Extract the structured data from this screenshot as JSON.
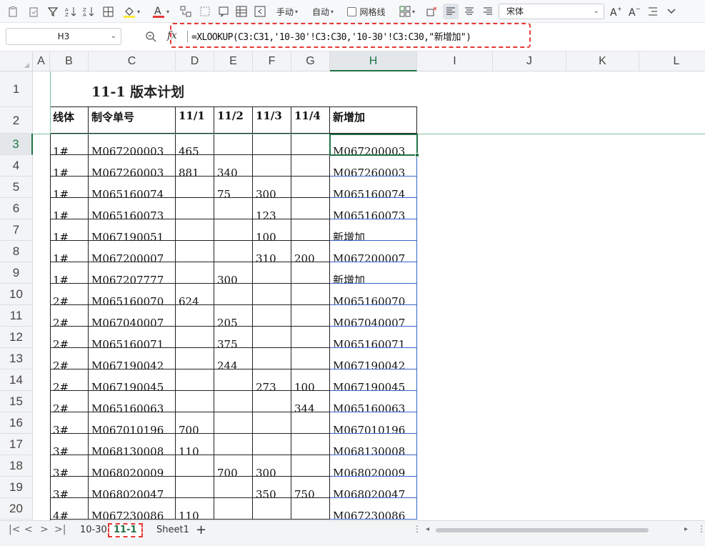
{
  "toolbar": {
    "font_name": "宋体",
    "fill_color": "#ffeb3b",
    "font_color": "#e53935",
    "manual_label": "手动",
    "auto_label": "自动",
    "gridlines_label": "网格线"
  },
  "formula_bar": {
    "name_box": "H3",
    "formula": "=XLOOKUP(C3:C31,'10-30'!C3:C30,'10-30'!C3:C30,\"新增加\")"
  },
  "sheet": {
    "columns": [
      "A",
      "B",
      "C",
      "D",
      "E",
      "F",
      "G",
      "H",
      "I",
      "J",
      "K",
      "L"
    ],
    "rows": [
      "1",
      "2",
      "3",
      "4",
      "5",
      "6",
      "7",
      "8",
      "9",
      "10",
      "11",
      "12",
      "13",
      "14",
      "15",
      "16",
      "17",
      "18",
      "19",
      "20"
    ],
    "title": "11-1  版本计划",
    "headers": [
      "线体",
      "制令单号",
      "11/1",
      "11/2",
      "11/3",
      "11/4",
      "新增加"
    ],
    "data": [
      [
        "1#",
        "M067200003",
        "465",
        "",
        "",
        "",
        "M067200003"
      ],
      [
        "1#",
        "M067260003",
        "881",
        "340",
        "",
        "",
        "M067260003"
      ],
      [
        "1#",
        "M065160074",
        "",
        "75",
        "300",
        "",
        "M065160074"
      ],
      [
        "1#",
        "M065160073",
        "",
        "",
        "123",
        "",
        "M065160073"
      ],
      [
        "1#",
        "M067190051",
        "",
        "",
        "100",
        "",
        "新增加"
      ],
      [
        "1#",
        "M067200007",
        "",
        "",
        "310",
        "200",
        "M067200007"
      ],
      [
        "1#",
        "M067207777",
        "",
        "300",
        "",
        "",
        "新增加"
      ],
      [
        "2#",
        "M065160070",
        "624",
        "",
        "",
        "",
        "M065160070"
      ],
      [
        "2#",
        "M067040007",
        "",
        "205",
        "",
        "",
        "M067040007"
      ],
      [
        "2#",
        "M065160071",
        "",
        "375",
        "",
        "",
        "M065160071"
      ],
      [
        "2#",
        "M067190042",
        "",
        "244",
        "",
        "",
        "M067190042"
      ],
      [
        "2#",
        "M067190045",
        "",
        "",
        "273",
        "100",
        "M067190045"
      ],
      [
        "2#",
        "M065160063",
        "",
        "",
        "",
        "344",
        "M065160063"
      ],
      [
        "3#",
        "M067010196",
        "700",
        "",
        "",
        "",
        "M067010196"
      ],
      [
        "3#",
        "M068130008",
        "110",
        "",
        "",
        "",
        "M068130008"
      ],
      [
        "3#",
        "M068020009",
        "",
        "700",
        "300",
        "",
        "M068020009"
      ],
      [
        "3#",
        "M068020047",
        "",
        "",
        "350",
        "750",
        "M068020047"
      ],
      [
        "4#",
        "M067230086",
        "110",
        "",
        "",
        "",
        "M067230086"
      ]
    ],
    "selected_column": "H",
    "selected_row": "3"
  },
  "sheet_tabs": [
    "10-30",
    "11-1",
    "Sheet1"
  ],
  "active_tab": "11-1"
}
